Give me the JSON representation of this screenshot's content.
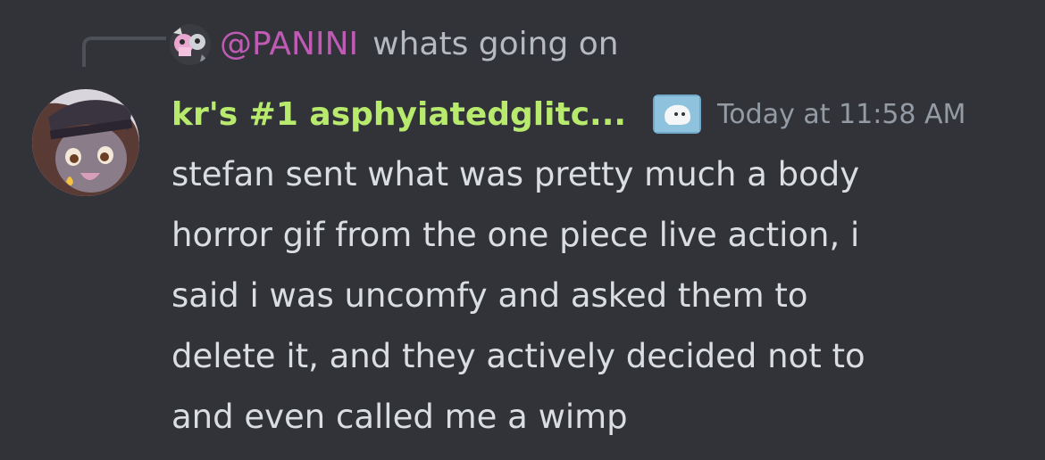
{
  "reply": {
    "author": "@PANINI",
    "text": "whats going on",
    "author_color": "#c05bb5"
  },
  "message": {
    "username": "kr's #1 asphyiatedglitc...",
    "username_color": "#b7ea6d",
    "timestamp": "Today at 11:58 AM",
    "lines": [
      "stefan sent what was pretty much a body",
      "horror gif from the one piece live action, i",
      "said i was uncomfy and asked them to",
      "delete it, and they actively decided not to",
      "and even called me a wimp"
    ]
  },
  "icons": {
    "reply_avatar": "reply-author-avatar",
    "avatar": "user-avatar",
    "role_icon": "role-icon"
  },
  "colors": {
    "background": "#313338",
    "text": "#dbdee1",
    "muted": "#949ba4"
  }
}
